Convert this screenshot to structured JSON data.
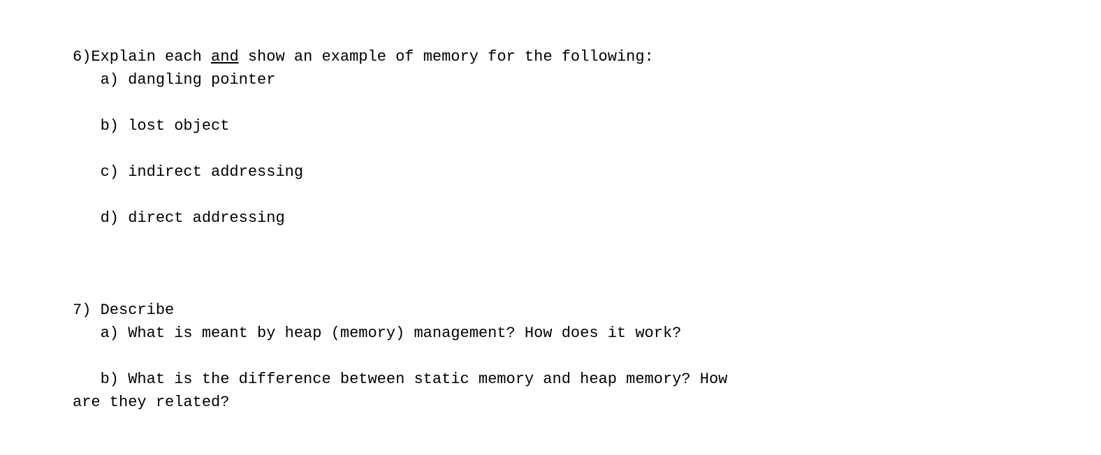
{
  "q6": {
    "header_pre": "6)Explain each ",
    "header_underlined": "and",
    "header_post": " show an example of memory for the following:",
    "a": "   a) dangling pointer",
    "b": "   b) lost object",
    "c": "   c) indirect addressing",
    "d": "   d) direct addressing"
  },
  "q7": {
    "header": "7) Describe",
    "a": "   a) What is meant by heap (memory) management? How does it work?",
    "b_line1": "   b) What is the difference between static memory and heap memory? How",
    "b_line2": "are they related?"
  }
}
